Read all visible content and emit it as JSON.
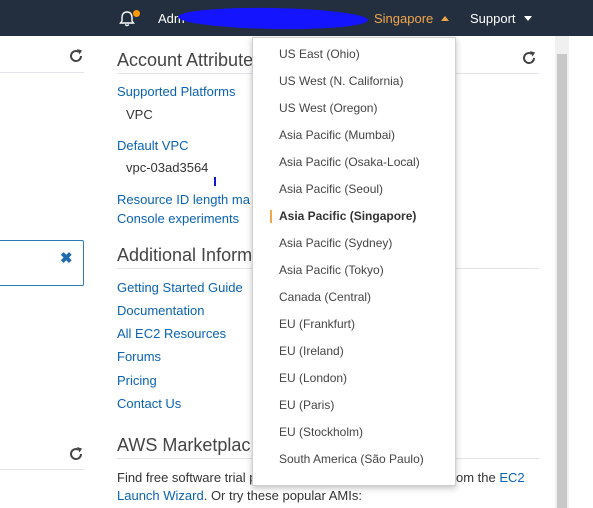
{
  "topbar": {
    "account_label": "Adm",
    "region_label": "Singapore",
    "support_label": "Support"
  },
  "account_attributes": {
    "title": "Account Attribute",
    "supported_platforms_label": "Supported Platforms",
    "supported_platforms_value": "VPC",
    "default_vpc_label": "Default VPC",
    "default_vpc_value": "vpc-03ad3564",
    "resource_id_label": "Resource ID length ma",
    "console_experiments_label": "Console experiments"
  },
  "additional_info": {
    "title": "Additional Inform",
    "links": [
      "Getting Started Guide",
      "Documentation",
      "All EC2 Resources",
      "Forums",
      "Pricing",
      "Contact Us"
    ]
  },
  "marketplace": {
    "title": "AWS Marketplac",
    "line1_start": "Find free software trial p",
    "line1_mid": "om the ",
    "line1_link": "EC2",
    "line2_link": "Launch Wizard",
    "line2_rest": ". Or try these popular AMIs:"
  },
  "region_menu": {
    "selected": "Asia Pacific (Singapore)",
    "items": [
      "US East (Ohio)",
      "US West (N. California)",
      "US West (Oregon)",
      "Asia Pacific (Mumbai)",
      "Asia Pacific (Osaka-Local)",
      "Asia Pacific (Seoul)",
      "Asia Pacific (Singapore)",
      "Asia Pacific (Sydney)",
      "Asia Pacific (Tokyo)",
      "Canada (Central)",
      "EU (Frankfurt)",
      "EU (Ireland)",
      "EU (London)",
      "EU (Paris)",
      "EU (Stockholm)",
      "South America (São Paulo)"
    ]
  },
  "alert": {
    "close_glyph": "✖"
  },
  "colors": {
    "topbar_bg": "#232f3e",
    "accent_orange": "#f2a64b",
    "link_blue": "#0a62b2"
  },
  "icons": [
    "bell-icon",
    "refresh-icon",
    "close-icon",
    "caret-up-icon",
    "caret-down-icon"
  ]
}
